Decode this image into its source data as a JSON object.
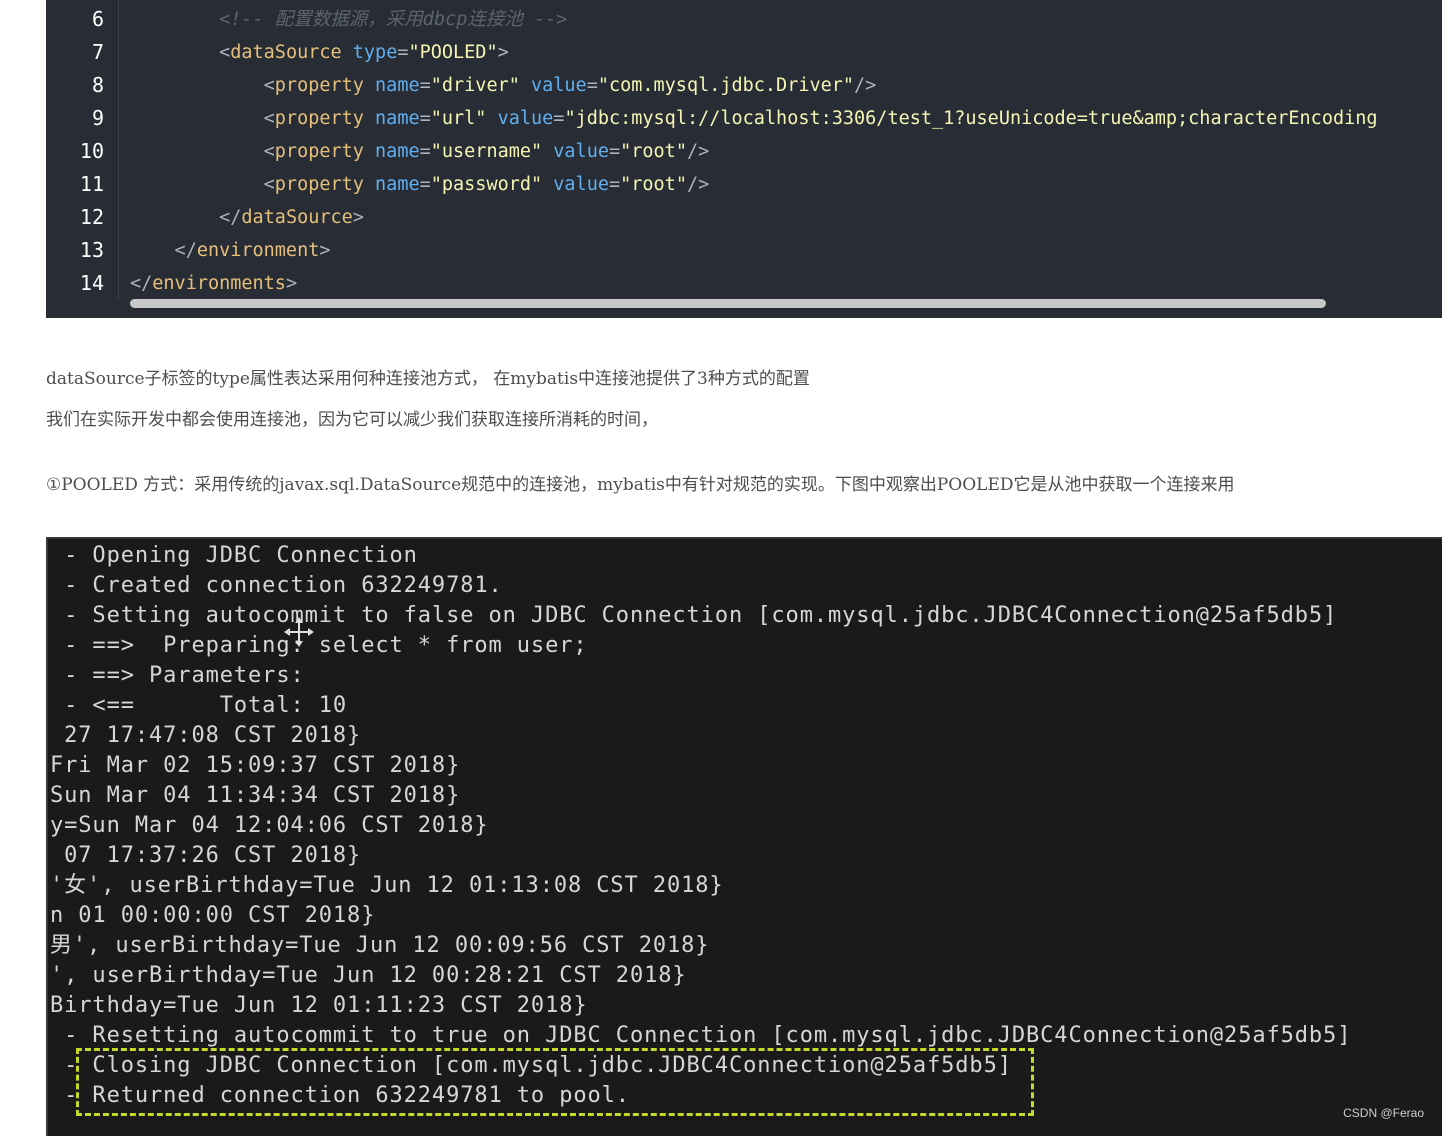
{
  "code": {
    "line_numbers": [
      "6",
      "7",
      "8",
      "9",
      "10",
      "11",
      "12",
      "13",
      "14"
    ],
    "lines": [
      [
        {
          "t": "        ",
          "c": "t-bracket"
        },
        {
          "t": "<!-- 配置数据源，采用dbcp连接池 -->",
          "c": "t-comment"
        }
      ],
      [
        {
          "t": "        <",
          "c": "t-bracket"
        },
        {
          "t": "dataSource",
          "c": "t-tag"
        },
        {
          "t": " ",
          "c": "t-eq"
        },
        {
          "t": "type",
          "c": "t-attr"
        },
        {
          "t": "=",
          "c": "t-eq"
        },
        {
          "t": "\"POOLED\"",
          "c": "t-str"
        },
        {
          "t": ">",
          "c": "t-bracket"
        }
      ],
      [
        {
          "t": "            <",
          "c": "t-bracket"
        },
        {
          "t": "property",
          "c": "t-tag"
        },
        {
          "t": " ",
          "c": "t-eq"
        },
        {
          "t": "name",
          "c": "t-attr"
        },
        {
          "t": "=",
          "c": "t-eq"
        },
        {
          "t": "\"driver\"",
          "c": "t-str"
        },
        {
          "t": " ",
          "c": "t-eq"
        },
        {
          "t": "value",
          "c": "t-attr"
        },
        {
          "t": "=",
          "c": "t-eq"
        },
        {
          "t": "\"com.mysql.jdbc.Driver\"",
          "c": "t-str"
        },
        {
          "t": "/>",
          "c": "t-bracket"
        }
      ],
      [
        {
          "t": "            <",
          "c": "t-bracket"
        },
        {
          "t": "property",
          "c": "t-tag"
        },
        {
          "t": " ",
          "c": "t-eq"
        },
        {
          "t": "name",
          "c": "t-attr"
        },
        {
          "t": "=",
          "c": "t-eq"
        },
        {
          "t": "\"url\"",
          "c": "t-str"
        },
        {
          "t": " ",
          "c": "t-eq"
        },
        {
          "t": "value",
          "c": "t-attr"
        },
        {
          "t": "=",
          "c": "t-eq"
        },
        {
          "t": "\"jdbc:mysql://localhost:3306/test_1?useUnicode=true&amp;characterEncoding",
          "c": "t-str"
        }
      ],
      [
        {
          "t": "            <",
          "c": "t-bracket"
        },
        {
          "t": "property",
          "c": "t-tag"
        },
        {
          "t": " ",
          "c": "t-eq"
        },
        {
          "t": "name",
          "c": "t-attr"
        },
        {
          "t": "=",
          "c": "t-eq"
        },
        {
          "t": "\"username\"",
          "c": "t-str"
        },
        {
          "t": " ",
          "c": "t-eq"
        },
        {
          "t": "value",
          "c": "t-attr"
        },
        {
          "t": "=",
          "c": "t-eq"
        },
        {
          "t": "\"root\"",
          "c": "t-str"
        },
        {
          "t": "/>",
          "c": "t-bracket"
        }
      ],
      [
        {
          "t": "            <",
          "c": "t-bracket"
        },
        {
          "t": "property",
          "c": "t-tag"
        },
        {
          "t": " ",
          "c": "t-eq"
        },
        {
          "t": "name",
          "c": "t-attr"
        },
        {
          "t": "=",
          "c": "t-eq"
        },
        {
          "t": "\"password\"",
          "c": "t-str"
        },
        {
          "t": " ",
          "c": "t-eq"
        },
        {
          "t": "value",
          "c": "t-attr"
        },
        {
          "t": "=",
          "c": "t-eq"
        },
        {
          "t": "\"root\"",
          "c": "t-str"
        },
        {
          "t": "/>",
          "c": "t-bracket"
        }
      ],
      [
        {
          "t": "        </",
          "c": "t-bracket"
        },
        {
          "t": "dataSource",
          "c": "t-tag"
        },
        {
          "t": ">",
          "c": "t-bracket"
        }
      ],
      [
        {
          "t": "    </",
          "c": "t-bracket"
        },
        {
          "t": "environment",
          "c": "t-tag"
        },
        {
          "t": ">",
          "c": "t-bracket"
        }
      ],
      [
        {
          "t": "</",
          "c": "t-bracket"
        },
        {
          "t": "environments",
          "c": "t-tag"
        },
        {
          "t": ">",
          "c": "t-bracket"
        }
      ]
    ]
  },
  "article": {
    "para1": "dataSource子标签的type属性表达采用何种连接池方式，  在mybatis中连接池提供了3种方式的配置",
    "para2": "我们在实际开发中都会使用连接池，因为它可以减少我们获取连接所消耗的时间，",
    "para3": "①POOLED 方式：采用传统的javax.sql.DataSource规范中的连接池，mybatis中有针对规范的实现。下图中观察出POOLED它是从池中获取一个连接来用"
  },
  "terminal": {
    "lines": [
      " - Opening JDBC Connection",
      " - Created connection 632249781.",
      " - Setting autocommit to false on JDBC Connection [com.mysql.jdbc.JDBC4Connection@25af5db5]",
      " - ==>  Preparing: select * from user;",
      " - ==> Parameters: ",
      " - <==      Total: 10",
      " 27 17:47:08 CST 2018}",
      "Fri Mar 02 15:09:37 CST 2018}",
      "Sun Mar 04 11:34:34 CST 2018}",
      "y=Sun Mar 04 12:04:06 CST 2018}",
      " 07 17:37:26 CST 2018}",
      "'女', userBirthday=Tue Jun 12 01:13:08 CST 2018}",
      "n 01 00:00:00 CST 2018}",
      "男', userBirthday=Tue Jun 12 00:09:56 CST 2018}",
      "', userBirthday=Tue Jun 12 00:28:21 CST 2018}",
      "Birthday=Tue Jun 12 01:11:23 CST 2018}",
      " - Resetting autocommit to true on JDBC Connection [com.mysql.jdbc.JDBC4Connection@25af5db5]",
      " - Closing JDBC Connection [com.mysql.jdbc.JDBC4Connection@25af5db5]",
      " - Returned connection 632249781 to pool."
    ],
    "watermark": "CSDN @Ferao"
  },
  "colors": {
    "code_bg": "#282c34",
    "terminal_bg": "#1a1a1a",
    "highlight_border": "#c6d92a"
  }
}
